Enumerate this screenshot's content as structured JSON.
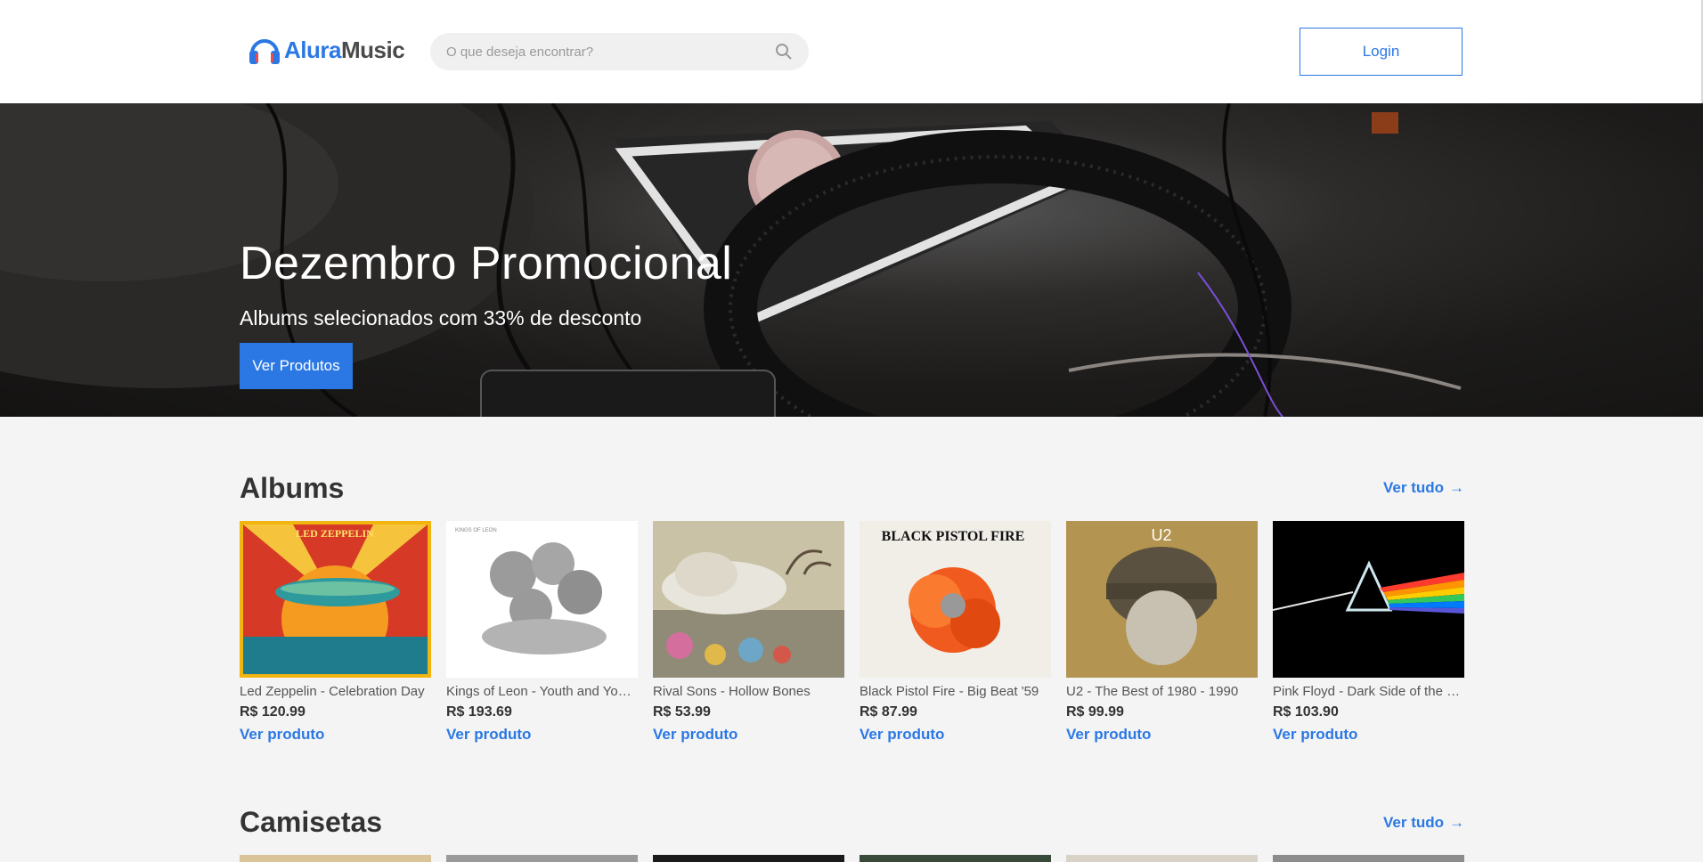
{
  "header": {
    "logo_part1": "Alura",
    "logo_part2": "Music",
    "search_placeholder": "O que deseja encontrar?",
    "login_label": "Login"
  },
  "hero": {
    "title": "Dezembro Promocional",
    "subtitle": "Albums selecionados com 33% de desconto",
    "button_label": "Ver Produtos"
  },
  "albums": {
    "title": "Albums",
    "see_all": "Ver tudo",
    "items": [
      {
        "name": "Led Zeppelin - Celebration Day",
        "price": "R$ 120.99",
        "link": "Ver produto",
        "cover_text": "LED ZEPPELIN"
      },
      {
        "name": "Kings of Leon - Youth and Young Manhood",
        "price": "R$ 193.69",
        "link": "Ver produto",
        "cover_text": "KINGS OF LEON"
      },
      {
        "name": "Rival Sons - Hollow Bones",
        "price": "R$ 53.99",
        "link": "Ver produto"
      },
      {
        "name": "Black Pistol Fire - Big Beat '59",
        "price": "R$ 87.99",
        "link": "Ver produto",
        "cover_text": "BLACK PISTOL FIRE"
      },
      {
        "name": "U2 - The Best of 1980 - 1990",
        "price": "R$ 99.99",
        "link": "Ver produto",
        "cover_text": "U2"
      },
      {
        "name": "Pink Floyd - Dark Side of the Moon",
        "price": "R$ 103.90",
        "link": "Ver produto"
      }
    ]
  },
  "shirts": {
    "title": "Camisetas",
    "see_all": "Ver tudo"
  },
  "colors": {
    "accent": "#2b78e4",
    "section_bg": "#f4f4f4"
  }
}
